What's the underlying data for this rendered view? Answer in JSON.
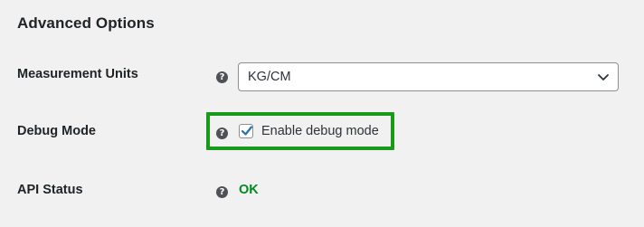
{
  "section": {
    "title": "Advanced Options"
  },
  "rows": {
    "measurement": {
      "label": "Measurement Units",
      "help_icon": "question-circle-icon",
      "selected_value": "KG/CM"
    },
    "debug": {
      "label": "Debug Mode",
      "help_icon": "question-circle-icon",
      "checkbox_label": "Enable debug mode",
      "checked": true
    },
    "api_status": {
      "label": "API Status",
      "help_icon": "question-circle-icon",
      "value": "OK"
    }
  },
  "colors": {
    "background": "#f1f1f1",
    "highlight": "#1a9a1a",
    "checkmark": "#2271b1",
    "status_ok": "#008a20",
    "help_icon_bg": "#4e5257"
  },
  "icons": {
    "help": "question-circle-icon",
    "dropdown": "chevron-down-icon",
    "check": "checkmark-icon"
  }
}
